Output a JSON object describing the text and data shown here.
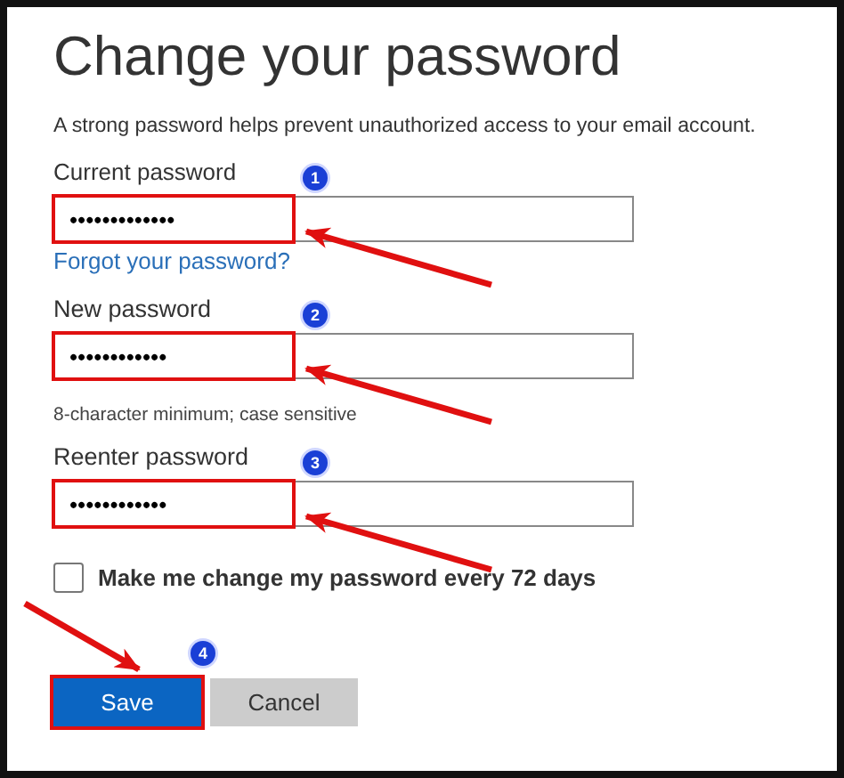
{
  "title": "Change your password",
  "description": "A strong password helps prevent unauthorized access to your email account.",
  "fields": [
    {
      "label": "Current password",
      "value": "•••••••••••••",
      "highlighted": true,
      "badge": "1",
      "link": "Forgot your password?"
    },
    {
      "label": "New password",
      "value": "••••••••••••",
      "highlighted": true,
      "badge": "2",
      "hint": "8-character minimum; case sensitive"
    },
    {
      "label": "Reenter password",
      "value": "••••••••••••",
      "highlighted": true,
      "badge": "3"
    }
  ],
  "checkbox": {
    "label": "Make me change my password every 72 days",
    "checked": false
  },
  "buttons": [
    {
      "label": "Save",
      "kind": "primary",
      "highlighted": true,
      "badge": "4"
    },
    {
      "label": "Cancel",
      "kind": "secondary",
      "highlighted": false
    }
  ]
}
